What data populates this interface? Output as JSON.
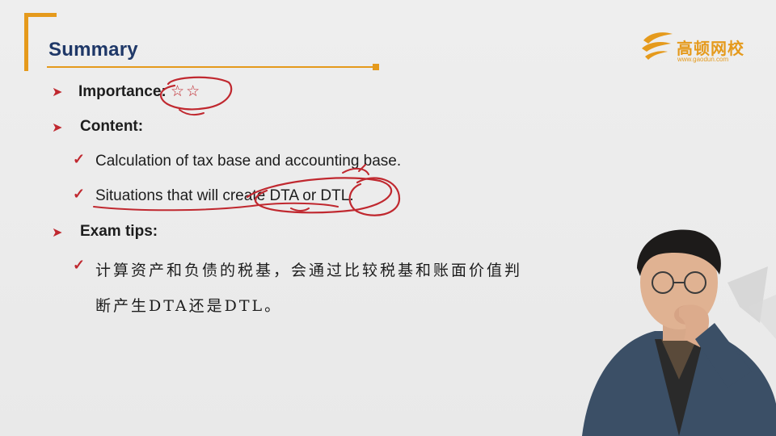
{
  "slide": {
    "title": "Summary",
    "logo": {
      "name": "高顿网校",
      "url": "www.gaodun.com"
    },
    "bullets": [
      {
        "label": "Importance:",
        "stars": "☆☆"
      },
      {
        "label": "Content:"
      },
      {
        "label": "Exam tips:"
      }
    ],
    "content_items": [
      "Calculation of tax base and accounting base.",
      "Situations that will create DTA or DTL."
    ],
    "exam_tip_lines": [
      "计算资产和负债的税基，会通过比较税基和账面价值判",
      "断产生DTA还是DTL。"
    ]
  },
  "colors": {
    "accent_orange": "#e59a1c",
    "title_blue": "#1f3868",
    "bullet_red": "#c0282f",
    "annotation_red": "#c0282f"
  },
  "icons": {
    "bullet": "arrowhead-icon",
    "sub_bullet": "checkmark-icon"
  }
}
